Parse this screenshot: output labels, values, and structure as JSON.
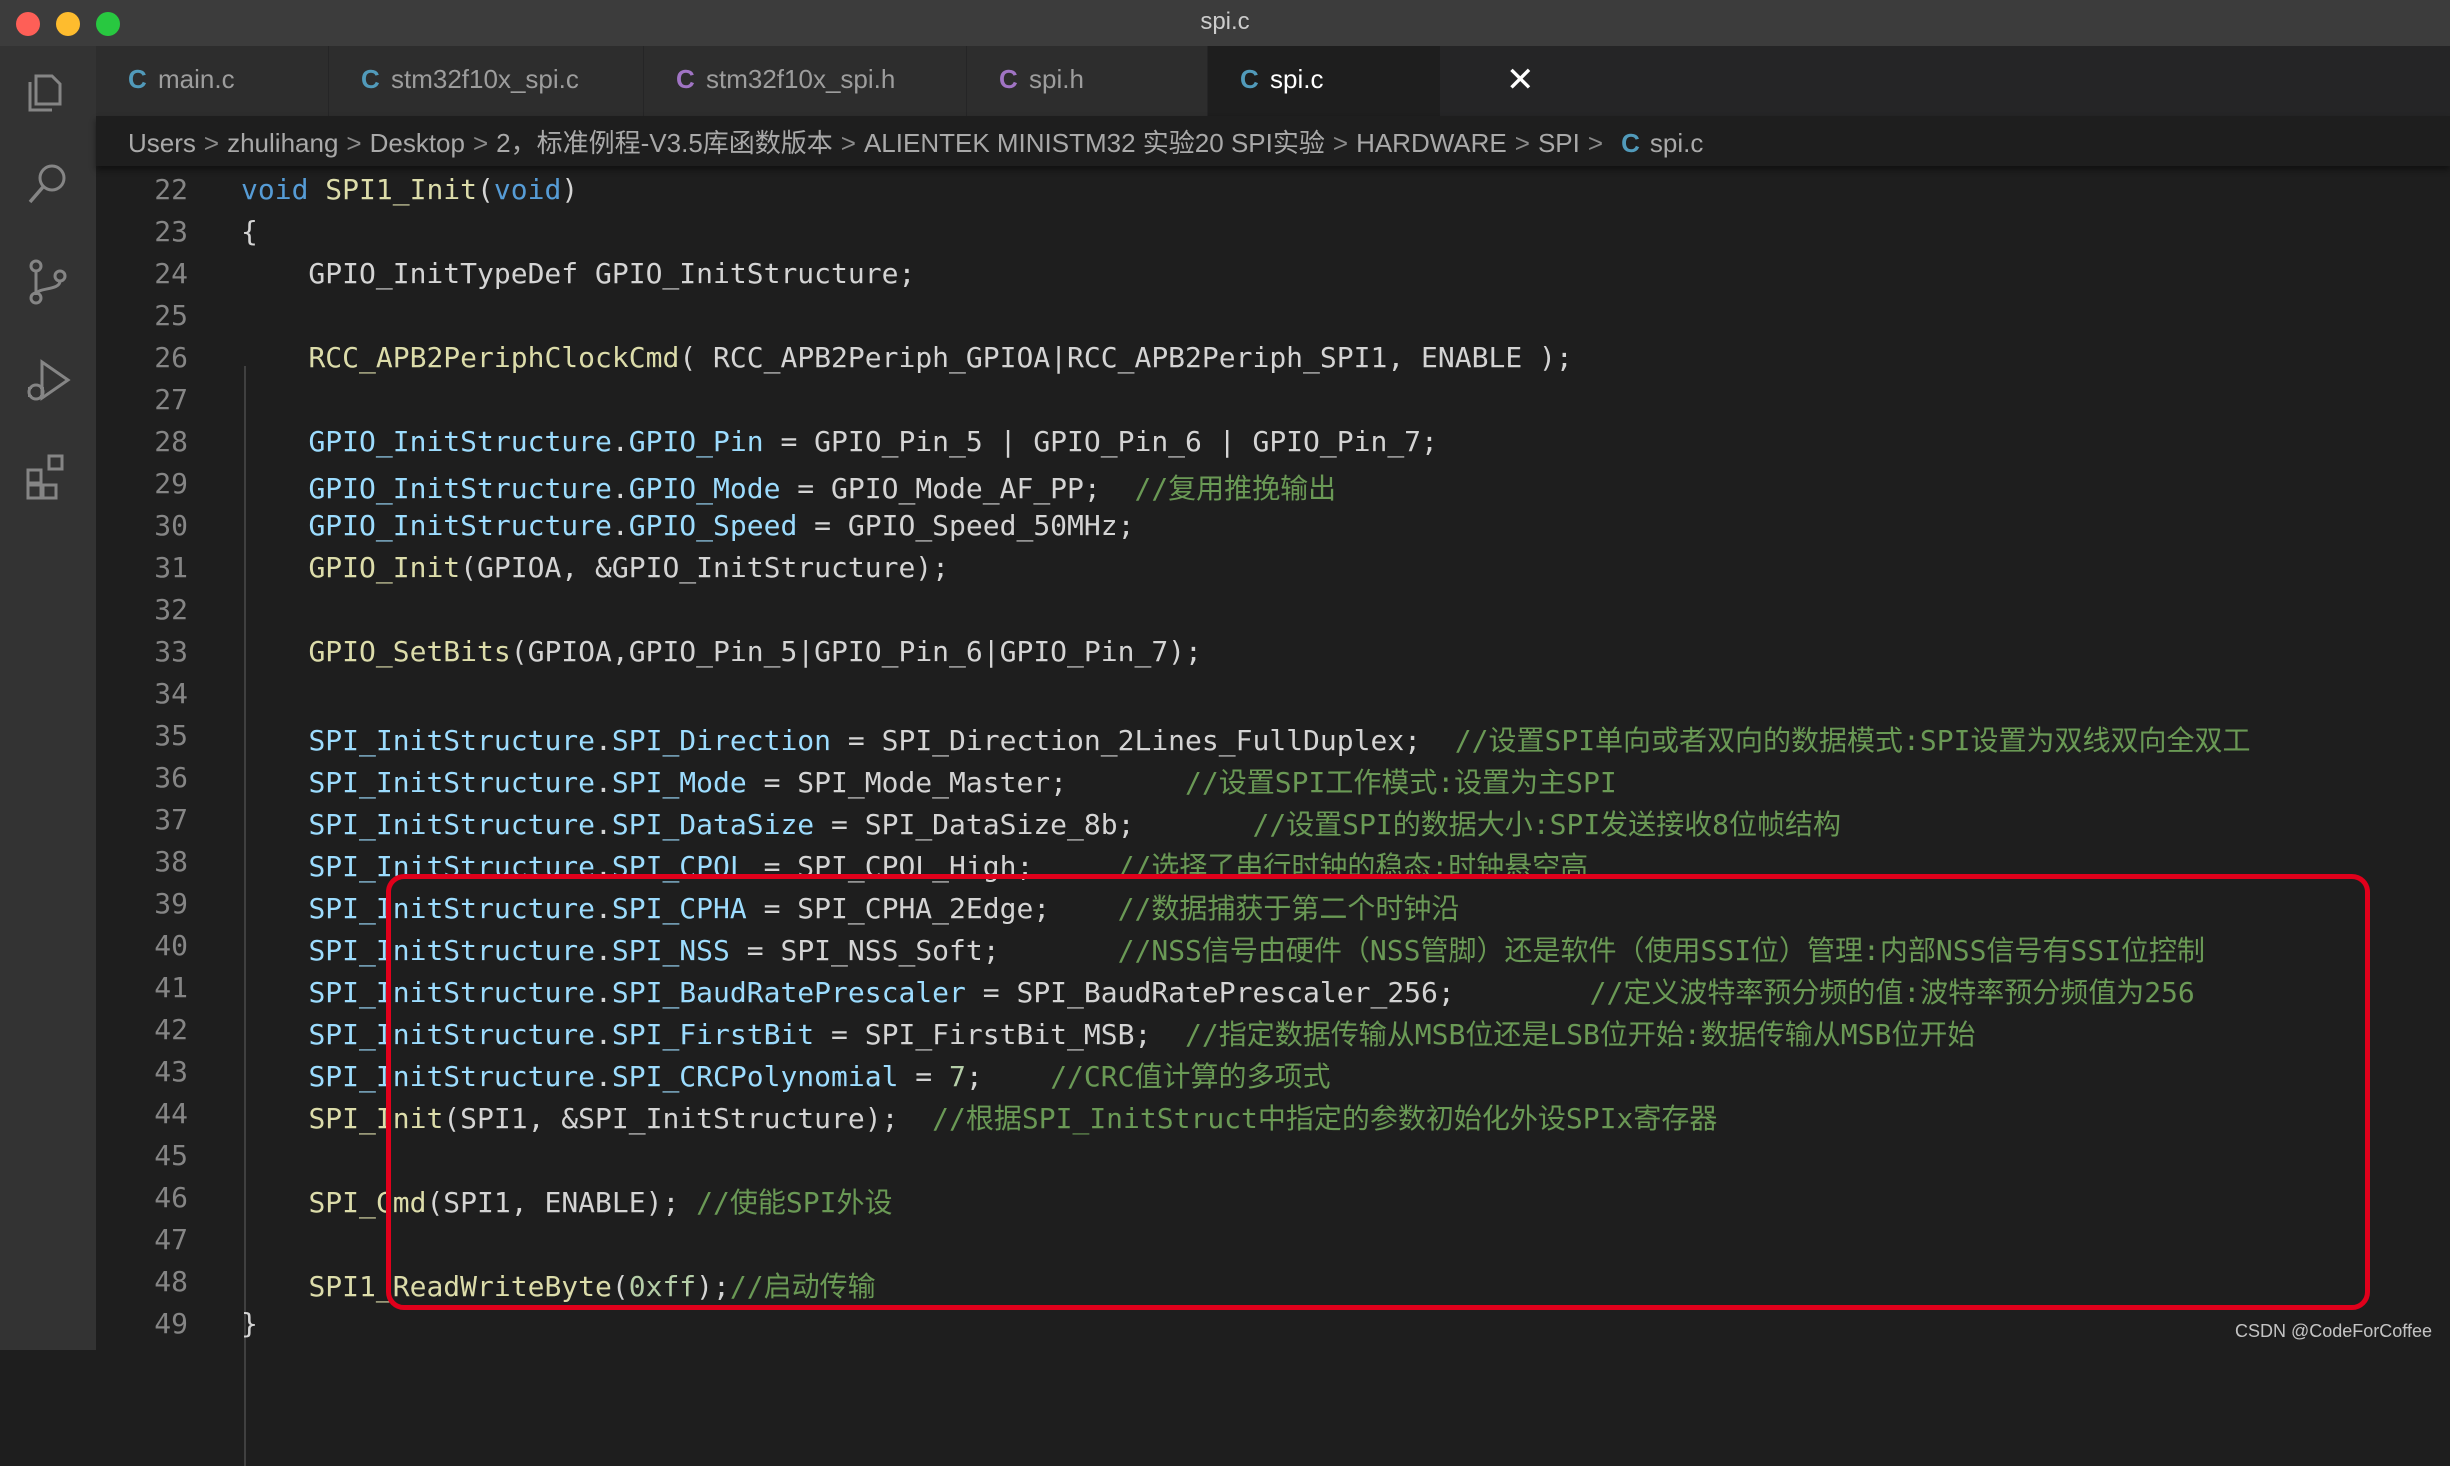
{
  "window": {
    "title": "spi.c"
  },
  "tabs": [
    {
      "label": "main.c",
      "icon": "C",
      "icon_color": "#519aba"
    },
    {
      "label": "stm32f10x_spi.c",
      "icon": "C",
      "icon_color": "#519aba"
    },
    {
      "label": "stm32f10x_spi.h",
      "icon": "C",
      "icon_color": "#a074c4"
    },
    {
      "label": "spi.h",
      "icon": "C",
      "icon_color": "#a074c4"
    },
    {
      "label": "spi.c",
      "icon": "C",
      "icon_color": "#519aba",
      "active": true,
      "close": "✕"
    }
  ],
  "breadcrumb": {
    "items": [
      "Users",
      "zhulihang",
      "Desktop",
      "2，标准例程-V3.5库函数版本",
      "ALIENTEK MINISTM32 实验20 SPI实验",
      "HARDWARE",
      "SPI"
    ],
    "file_icon": "C",
    "file": "spi.c",
    "separator": ">"
  },
  "lines": [
    {
      "n": "22",
      "tokens": [
        [
          "kw",
          "void"
        ],
        [
          "plain",
          " "
        ],
        [
          "fn",
          "SPI1_Init"
        ],
        [
          "plain",
          "("
        ],
        [
          "kw",
          "void"
        ],
        [
          "plain",
          ")"
        ]
      ]
    },
    {
      "n": "23",
      "tokens": [
        [
          "plain",
          "{"
        ]
      ]
    },
    {
      "n": "24",
      "tokens": [
        [
          "plain",
          "    GPIO_InitTypeDef GPIO_InitStructure;"
        ]
      ]
    },
    {
      "n": "25",
      "tokens": []
    },
    {
      "n": "26",
      "tokens": [
        [
          "plain",
          "    "
        ],
        [
          "fn",
          "RCC_APB2PeriphClockCmd"
        ],
        [
          "plain",
          "( RCC_APB2Periph_GPIOA|RCC_APB2Periph_SPI1, ENABLE );"
        ]
      ]
    },
    {
      "n": "27",
      "tokens": []
    },
    {
      "n": "28",
      "tokens": [
        [
          "plain",
          "    "
        ],
        [
          "var",
          "GPIO_InitStructure"
        ],
        [
          "plain",
          "."
        ],
        [
          "var",
          "GPIO_Pin"
        ],
        [
          "plain",
          " = GPIO_Pin_5 | GPIO_Pin_6 | GPIO_Pin_7;"
        ]
      ]
    },
    {
      "n": "29",
      "tokens": [
        [
          "plain",
          "    "
        ],
        [
          "var",
          "GPIO_InitStructure"
        ],
        [
          "plain",
          "."
        ],
        [
          "var",
          "GPIO_Mode"
        ],
        [
          "plain",
          " = GPIO_Mode_AF_PP;  "
        ],
        [
          "cmt",
          "//复用推挽输出"
        ]
      ]
    },
    {
      "n": "30",
      "tokens": [
        [
          "plain",
          "    "
        ],
        [
          "var",
          "GPIO_InitStructure"
        ],
        [
          "plain",
          "."
        ],
        [
          "var",
          "GPIO_Speed"
        ],
        [
          "plain",
          " = GPIO_Speed_50MHz;"
        ]
      ]
    },
    {
      "n": "31",
      "tokens": [
        [
          "plain",
          "    "
        ],
        [
          "fn",
          "GPIO_Init"
        ],
        [
          "plain",
          "(GPIOA, &GPIO_InitStructure);"
        ]
      ]
    },
    {
      "n": "32",
      "tokens": []
    },
    {
      "n": "33",
      "tokens": [
        [
          "plain",
          "    "
        ],
        [
          "fn",
          "GPIO_SetBits"
        ],
        [
          "plain",
          "(GPIOA,GPIO_Pin_5|GPIO_Pin_6|GPIO_Pin_7);"
        ]
      ]
    },
    {
      "n": "34",
      "tokens": []
    },
    {
      "n": "35",
      "tokens": [
        [
          "plain",
          "    "
        ],
        [
          "var",
          "SPI_InitStructure"
        ],
        [
          "plain",
          "."
        ],
        [
          "var",
          "SPI_Direction"
        ],
        [
          "plain",
          " = SPI_Direction_2Lines_FullDuplex;  "
        ],
        [
          "cmt",
          "//设置SPI单向或者双向的数据模式:SPI设置为双线双向全双工"
        ]
      ]
    },
    {
      "n": "36",
      "tokens": [
        [
          "plain",
          "    "
        ],
        [
          "var",
          "SPI_InitStructure"
        ],
        [
          "plain",
          "."
        ],
        [
          "var",
          "SPI_Mode"
        ],
        [
          "plain",
          " = SPI_Mode_Master;       "
        ],
        [
          "cmt",
          "//设置SPI工作模式:设置为主SPI"
        ]
      ]
    },
    {
      "n": "37",
      "tokens": [
        [
          "plain",
          "    "
        ],
        [
          "var",
          "SPI_InitStructure"
        ],
        [
          "plain",
          "."
        ],
        [
          "var",
          "SPI_DataSize"
        ],
        [
          "plain",
          " = SPI_DataSize_8b;       "
        ],
        [
          "cmt",
          "//设置SPI的数据大小:SPI发送接收8位帧结构"
        ]
      ]
    },
    {
      "n": "38",
      "tokens": [
        [
          "plain",
          "    "
        ],
        [
          "var",
          "SPI_InitStructure"
        ],
        [
          "plain",
          "."
        ],
        [
          "var",
          "SPI_CPOL"
        ],
        [
          "plain",
          " = SPI_CPOL_High;     "
        ],
        [
          "cmt",
          "//选择了串行时钟的稳态:时钟悬空高"
        ]
      ]
    },
    {
      "n": "39",
      "tokens": [
        [
          "plain",
          "    "
        ],
        [
          "var",
          "SPI_InitStructure"
        ],
        [
          "plain",
          "."
        ],
        [
          "var",
          "SPI_CPHA"
        ],
        [
          "plain",
          " = SPI_CPHA_2Edge;    "
        ],
        [
          "cmt",
          "//数据捕获于第二个时钟沿"
        ]
      ]
    },
    {
      "n": "40",
      "tokens": [
        [
          "plain",
          "    "
        ],
        [
          "var",
          "SPI_InitStructure"
        ],
        [
          "plain",
          "."
        ],
        [
          "var",
          "SPI_NSS"
        ],
        [
          "plain",
          " = SPI_NSS_Soft;       "
        ],
        [
          "cmt",
          "//NSS信号由硬件（NSS管脚）还是软件（使用SSI位）管理:内部NSS信号有SSI位控制"
        ]
      ]
    },
    {
      "n": "41",
      "tokens": [
        [
          "plain",
          "    "
        ],
        [
          "var",
          "SPI_InitStructure"
        ],
        [
          "plain",
          "."
        ],
        [
          "var",
          "SPI_BaudRatePrescaler"
        ],
        [
          "plain",
          " = SPI_BaudRatePrescaler_256;        "
        ],
        [
          "cmt",
          "//定义波特率预分频的值:波特率预分频值为256"
        ]
      ]
    },
    {
      "n": "42",
      "tokens": [
        [
          "plain",
          "    "
        ],
        [
          "var",
          "SPI_InitStructure"
        ],
        [
          "plain",
          "."
        ],
        [
          "var",
          "SPI_FirstBit"
        ],
        [
          "plain",
          " = SPI_FirstBit_MSB;  "
        ],
        [
          "cmt",
          "//指定数据传输从MSB位还是LSB位开始:数据传输从MSB位开始"
        ]
      ]
    },
    {
      "n": "43",
      "tokens": [
        [
          "plain",
          "    "
        ],
        [
          "var",
          "SPI_InitStructure"
        ],
        [
          "plain",
          "."
        ],
        [
          "var",
          "SPI_CRCPolynomial"
        ],
        [
          "plain",
          " = "
        ],
        [
          "num",
          "7"
        ],
        [
          "plain",
          ";    "
        ],
        [
          "cmt",
          "//CRC值计算的多项式"
        ]
      ]
    },
    {
      "n": "44",
      "tokens": [
        [
          "plain",
          "    "
        ],
        [
          "fn",
          "SPI_Init"
        ],
        [
          "plain",
          "(SPI1, &SPI_InitStructure);  "
        ],
        [
          "cmt",
          "//根据SPI_InitStruct中指定的参数初始化外设SPIx寄存器"
        ]
      ]
    },
    {
      "n": "45",
      "tokens": []
    },
    {
      "n": "46",
      "tokens": [
        [
          "plain",
          "    "
        ],
        [
          "fn",
          "SPI_Cmd"
        ],
        [
          "plain",
          "(SPI1, ENABLE); "
        ],
        [
          "cmt",
          "//使能SPI外设"
        ]
      ]
    },
    {
      "n": "47",
      "tokens": []
    },
    {
      "n": "48",
      "tokens": [
        [
          "plain",
          "    "
        ],
        [
          "fn",
          "SPI1_ReadWriteByte"
        ],
        [
          "plain",
          "("
        ],
        [
          "num",
          "0xff"
        ],
        [
          "plain",
          ");"
        ],
        [
          "cmt",
          "//启动传输"
        ]
      ]
    },
    {
      "n": "49",
      "tokens": [
        [
          "plain",
          "}"
        ]
      ]
    }
  ],
  "watermark": "CSDN @CodeForCoffee",
  "colors": {
    "highlight_box": "#e0001b",
    "accent": "#007acc"
  },
  "activity_icons": [
    "explorer-icon",
    "search-icon",
    "source-control-icon",
    "run-debug-icon",
    "extensions-icon"
  ]
}
